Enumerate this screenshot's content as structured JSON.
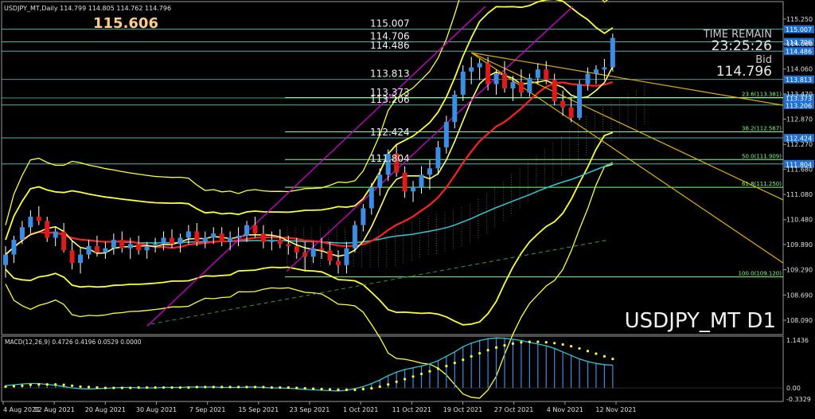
{
  "header": {
    "info": "USDJPY_MT,Daily  114.799 114.805 114.762 114.796",
    "big_price": "115.606"
  },
  "panel": {
    "time_remain_label": "TIME REMAIN",
    "time_remain": "23:25:26",
    "bid_label": "Bid",
    "bid_value": "114.796"
  },
  "watermark": "USDJPY_MT D1",
  "macd": {
    "label": "MACD(12,26,9) 0.4726 0.4196 0.0529 0.0000",
    "scale": [
      "1.1436",
      "0.00",
      "-0.3329"
    ]
  },
  "colors": {
    "background": "#000000",
    "bull": "#3a8ee6",
    "bear": "#e01a1a",
    "bands": "#ffff33",
    "trend_main": "#e0b000",
    "channel": "#d000d0",
    "ma_red": "#ff2020",
    "ma_cyan": "#30c8d8",
    "hline": "#80ff80",
    "level_tag": "#1f70d0"
  },
  "chart_data": {
    "type": "candlestick",
    "symbol": "USDJPY_MT",
    "timeframe": "Daily",
    "y_axis": [
      "115.250",
      "114.660",
      "114.060",
      "113.470",
      "112.870",
      "112.270",
      "111.680",
      "111.080",
      "110.480",
      "109.890",
      "109.290",
      "108.690",
      "108.090"
    ],
    "ylim": [
      107.9,
      115.55
    ],
    "x_axis": [
      "4 Aug 2021",
      "12 Aug 2021",
      "20 Aug 2021",
      "30 Aug 2021",
      "7 Sep 2021",
      "15 Sep 2021",
      "23 Sep 2021",
      "1 Oct 2021",
      "11 Oct 2021",
      "19 Oct 2021",
      "27 Oct 2021",
      "4 Nov 2021",
      "12 Nov 2021"
    ],
    "candles": [
      [
        109.4,
        109.85,
        109.1,
        109.65
      ],
      [
        109.65,
        110.1,
        109.45,
        110.0
      ],
      [
        110.0,
        110.45,
        109.9,
        110.3
      ],
      [
        110.3,
        110.7,
        110.15,
        110.55
      ],
      [
        110.55,
        110.8,
        110.35,
        110.45
      ],
      [
        110.45,
        110.55,
        109.95,
        110.05
      ],
      [
        110.05,
        110.3,
        109.85,
        110.2
      ],
      [
        110.2,
        110.4,
        109.7,
        109.75
      ],
      [
        109.75,
        110.0,
        109.3,
        109.45
      ],
      [
        109.45,
        109.8,
        109.2,
        109.65
      ],
      [
        109.65,
        110.0,
        109.55,
        109.85
      ],
      [
        109.85,
        110.1,
        109.6,
        109.7
      ],
      [
        109.7,
        109.95,
        109.55,
        109.8
      ],
      [
        109.8,
        110.15,
        109.65,
        110.0
      ],
      [
        110.0,
        110.2,
        109.7,
        109.8
      ],
      [
        109.8,
        110.05,
        109.55,
        109.9
      ],
      [
        109.9,
        110.1,
        109.65,
        109.75
      ],
      [
        109.75,
        109.95,
        109.55,
        109.85
      ],
      [
        109.85,
        110.05,
        109.7,
        109.9
      ],
      [
        109.9,
        110.2,
        109.75,
        110.05
      ],
      [
        110.05,
        110.25,
        109.8,
        109.9
      ],
      [
        109.9,
        110.15,
        109.7,
        110.05
      ],
      [
        110.05,
        110.35,
        109.9,
        110.2
      ],
      [
        110.2,
        110.4,
        109.85,
        109.95
      ],
      [
        109.95,
        110.2,
        109.8,
        110.05
      ],
      [
        110.05,
        110.3,
        109.9,
        110.15
      ],
      [
        110.15,
        110.3,
        109.85,
        109.95
      ],
      [
        109.95,
        110.2,
        109.75,
        110.05
      ],
      [
        110.05,
        110.3,
        109.85,
        110.1
      ],
      [
        110.1,
        110.45,
        109.95,
        110.35
      ],
      [
        110.35,
        110.55,
        110.05,
        110.15
      ],
      [
        110.15,
        110.35,
        109.8,
        109.95
      ],
      [
        109.95,
        110.2,
        109.75,
        110.0
      ],
      [
        110.0,
        110.25,
        109.8,
        109.9
      ],
      [
        109.9,
        110.1,
        109.65,
        109.85
      ],
      [
        109.85,
        110.05,
        109.55,
        109.7
      ],
      [
        109.7,
        109.95,
        109.25,
        109.6
      ],
      [
        109.6,
        109.95,
        109.45,
        109.8
      ],
      [
        109.8,
        110.05,
        109.55,
        109.75
      ],
      [
        109.75,
        109.95,
        109.4,
        109.5
      ],
      [
        109.5,
        109.75,
        109.2,
        109.4
      ],
      [
        109.4,
        109.95,
        109.2,
        109.8
      ],
      [
        109.8,
        110.45,
        109.7,
        110.35
      ],
      [
        110.35,
        110.85,
        110.2,
        110.75
      ],
      [
        110.75,
        111.35,
        110.6,
        111.25
      ],
      [
        111.25,
        111.7,
        111.05,
        111.55
      ],
      [
        111.55,
        112.15,
        111.4,
        112.05
      ],
      [
        112.05,
        112.25,
        111.5,
        111.6
      ],
      [
        111.6,
        111.75,
        111.0,
        111.15
      ],
      [
        111.15,
        111.4,
        110.9,
        111.25
      ],
      [
        111.25,
        111.75,
        111.1,
        111.55
      ],
      [
        111.55,
        111.9,
        111.2,
        111.7
      ],
      [
        111.7,
        112.35,
        111.55,
        112.2
      ],
      [
        112.2,
        112.95,
        112.05,
        112.8
      ],
      [
        112.8,
        113.55,
        112.65,
        113.45
      ],
      [
        113.45,
        114.15,
        113.3,
        114.0
      ],
      [
        114.0,
        114.35,
        113.7,
        114.1
      ],
      [
        114.1,
        114.3,
        113.8,
        114.2
      ],
      [
        114.2,
        114.35,
        113.55,
        113.7
      ],
      [
        113.7,
        114.05,
        113.45,
        113.95
      ],
      [
        113.95,
        114.25,
        113.5,
        113.6
      ],
      [
        113.6,
        113.9,
        113.3,
        113.75
      ],
      [
        113.75,
        114.05,
        113.4,
        113.5
      ],
      [
        113.5,
        113.95,
        113.4,
        113.85
      ],
      [
        113.85,
        114.2,
        113.7,
        114.05
      ],
      [
        114.05,
        114.25,
        113.7,
        113.8
      ],
      [
        113.8,
        113.95,
        113.2,
        113.3
      ],
      [
        113.3,
        113.55,
        112.95,
        113.15
      ],
      [
        113.15,
        113.4,
        112.8,
        112.9
      ],
      [
        112.9,
        113.8,
        112.85,
        113.7
      ],
      [
        113.7,
        114.1,
        113.55,
        113.95
      ],
      [
        113.95,
        114.15,
        113.7,
        114.05
      ],
      [
        114.05,
        114.3,
        113.8,
        114.1
      ],
      [
        114.1,
        114.9,
        114.0,
        114.8
      ]
    ],
    "price_levels": [
      "115.007",
      "114.706",
      "114.486",
      "113.813",
      "113.373",
      "113.206",
      "112.424",
      "111.804"
    ],
    "fib_levels": [
      "23.6(113.381)",
      "38.2(112.567)",
      "50.0(111.909)",
      "61.8(111.250)",
      "100.0(109.120)"
    ],
    "macd_main": [
      0.05,
      0.07,
      0.09,
      0.1,
      0.1,
      0.08,
      0.06,
      0.03,
      0.0,
      -0.02,
      -0.03,
      -0.02,
      -0.01,
      0.0,
      0.01,
      0.01,
      0.0,
      0.0,
      0.0,
      0.01,
      0.01,
      0.01,
      0.02,
      0.02,
      0.02,
      0.02,
      0.01,
      0.01,
      0.01,
      0.02,
      0.02,
      0.01,
      0.0,
      0.0,
      -0.01,
      -0.02,
      -0.04,
      -0.05,
      -0.06,
      -0.07,
      -0.08,
      -0.06,
      -0.02,
      0.03,
      0.1,
      0.18,
      0.28,
      0.36,
      0.42,
      0.46,
      0.5,
      0.55,
      0.62,
      0.72,
      0.82,
      0.94,
      1.02,
      1.08,
      1.12,
      1.14,
      1.13,
      1.11,
      1.08,
      1.04,
      1.0,
      0.96,
      0.9,
      0.82,
      0.74,
      0.66,
      0.6,
      0.56,
      0.53,
      0.52
    ],
    "macd_signal": [
      0.03,
      0.04,
      0.05,
      0.07,
      0.08,
      0.08,
      0.08,
      0.07,
      0.05,
      0.03,
      0.02,
      0.01,
      0.0,
      0.0,
      0.0,
      0.0,
      0.01,
      0.01,
      0.01,
      0.01,
      0.01,
      0.01,
      0.01,
      0.02,
      0.02,
      0.02,
      0.02,
      0.02,
      0.02,
      0.02,
      0.02,
      0.02,
      0.01,
      0.01,
      0.01,
      0.0,
      -0.01,
      -0.02,
      -0.03,
      -0.04,
      -0.05,
      -0.05,
      -0.05,
      -0.03,
      -0.01,
      0.03,
      0.08,
      0.14,
      0.2,
      0.26,
      0.32,
      0.38,
      0.44,
      0.5,
      0.57,
      0.64,
      0.72,
      0.79,
      0.86,
      0.92,
      0.97,
      1.01,
      1.04,
      1.05,
      1.05,
      1.04,
      1.02,
      0.99,
      0.95,
      0.9,
      0.84,
      0.78,
      0.72,
      0.66
    ]
  }
}
